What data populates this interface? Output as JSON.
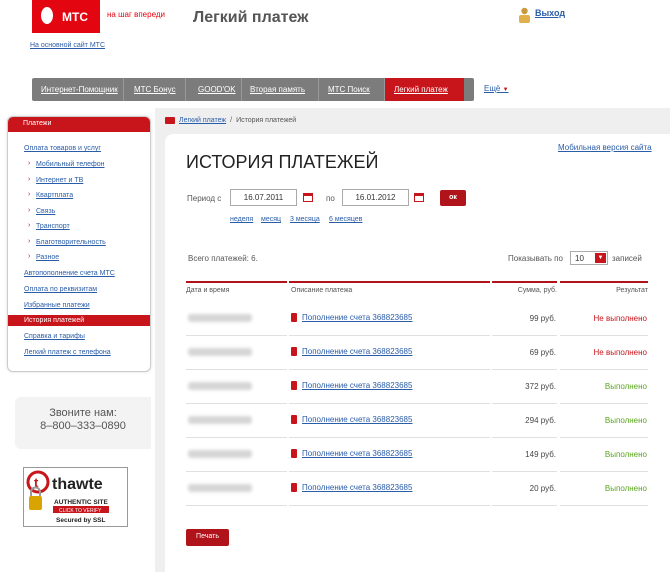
{
  "header": {
    "logo_text": "МТС",
    "slogan": "на шаг впереди",
    "app_title": "Легкий платеж",
    "logout": "Выход",
    "back_link": "На основной сайт МТС"
  },
  "topnav": {
    "items": [
      "Интернет-Помощник",
      "МТС Бонус",
      "GOOD'OK",
      "Вторая память",
      "МТС Поиск",
      "Легкий платеж"
    ],
    "active_index": 5,
    "more": "Ещё"
  },
  "sidebar": {
    "header": "Платежи",
    "items": [
      {
        "label": "Оплата товаров и услуг",
        "sub": false
      },
      {
        "label": "Мобильный телефон",
        "sub": true
      },
      {
        "label": "Интернет и ТВ",
        "sub": true
      },
      {
        "label": "Квартплата",
        "sub": true
      },
      {
        "label": "Связь",
        "sub": true
      },
      {
        "label": "Транспорт",
        "sub": true
      },
      {
        "label": "Благотворительность",
        "sub": true
      },
      {
        "label": "Разное",
        "sub": true
      },
      {
        "label": "Автопополнение счета МТС",
        "sub": false
      },
      {
        "label": "Оплата по реквизитам",
        "sub": false
      },
      {
        "label": "Избранные платежи",
        "sub": false
      },
      {
        "label": "История платежей",
        "sub": false,
        "active": true
      },
      {
        "label": "Справка и тарифы",
        "sub": false
      },
      {
        "label": "Легкий платеж с телефона",
        "sub": false
      }
    ],
    "call_us": "Звоните нам:",
    "phone": "8–800–333–0890"
  },
  "thawte": {
    "brand": "thawte",
    "line1": "AUTHENTIC SITE",
    "line2": "CLICK TO VERIFY",
    "line3": "Secured by SSL"
  },
  "breadcrumb": {
    "link": "Легкий платеж",
    "current": "История платежей"
  },
  "main": {
    "mobile_link": "Мобильная версия сайта",
    "title": "ИСТОРИЯ ПЛАТЕЖЕЙ",
    "period_label": "Период с",
    "date_from": "16.07.2011",
    "to_label": "по",
    "date_to": "16.01.2012",
    "ok": "ок",
    "quick_periods": [
      "неделя",
      "месяц",
      "3 месяца",
      "6 месяцев"
    ],
    "total": "Всего платежей: 6.",
    "show_label": "Показывать по",
    "per_page": "10",
    "records_label": "записей",
    "columns": [
      "Дата и время",
      "Описание платежа",
      "Сумма, руб.",
      "Результат"
    ],
    "rows": [
      {
        "desc": "Пополнение счета 368823685",
        "sum": "99 руб.",
        "result": "Не выполнено",
        "ok": false
      },
      {
        "desc": "Пополнение счета 368823685",
        "sum": "69 руб.",
        "result": "Не выполнено",
        "ok": false
      },
      {
        "desc": "Пополнение счета 368823685",
        "sum": "372 руб.",
        "result": "Выполнено",
        "ok": true
      },
      {
        "desc": "Пополнение счета 368823685",
        "sum": "294 руб.",
        "result": "Выполнено",
        "ok": true
      },
      {
        "desc": "Пополнение счета 368823685",
        "sum": "149 руб.",
        "result": "Выполнено",
        "ok": true
      },
      {
        "desc": "Пополнение счета 368823685",
        "sum": "20 руб.",
        "result": "Выполнено",
        "ok": true
      }
    ],
    "print": "Печать"
  },
  "colors": {
    "brand_red": "#e30611",
    "fail": "#c8141b",
    "success": "#5aa61e",
    "link": "#2a5da8"
  }
}
